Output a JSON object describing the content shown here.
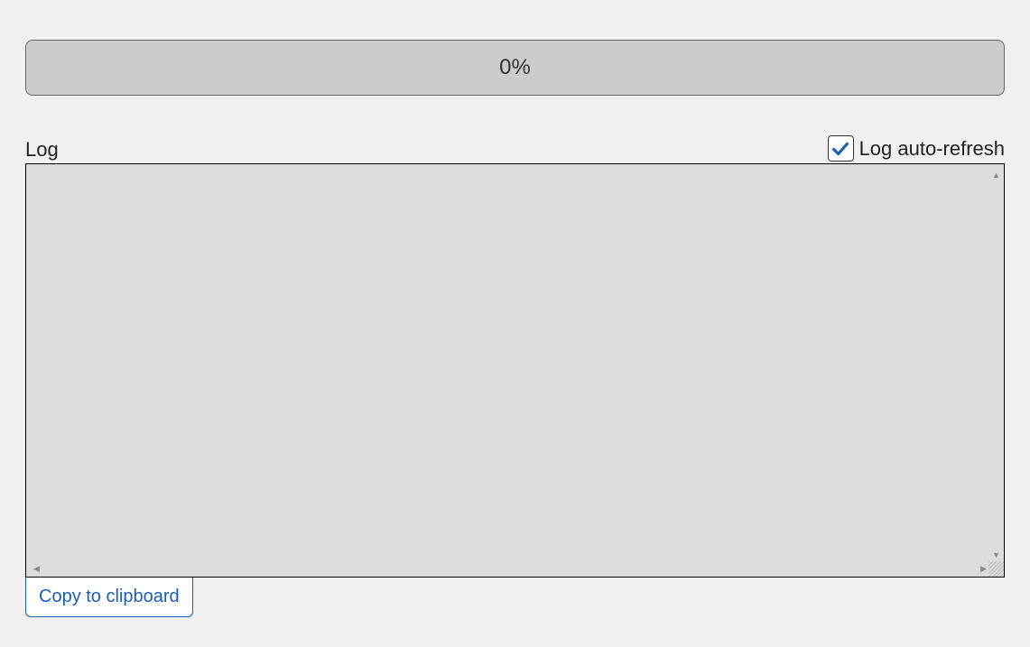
{
  "progress": {
    "percent_label": "0%",
    "value": 0
  },
  "log": {
    "label": "Log",
    "content": ""
  },
  "auto_refresh": {
    "label": "Log auto-refresh",
    "checked": true
  },
  "buttons": {
    "copy_label": "Copy to clipboard"
  },
  "colors": {
    "accent": "#1a5fb4",
    "progress_bg": "#cccccc",
    "log_bg": "#dcdcdc",
    "page_bg": "#f0f0f0"
  }
}
